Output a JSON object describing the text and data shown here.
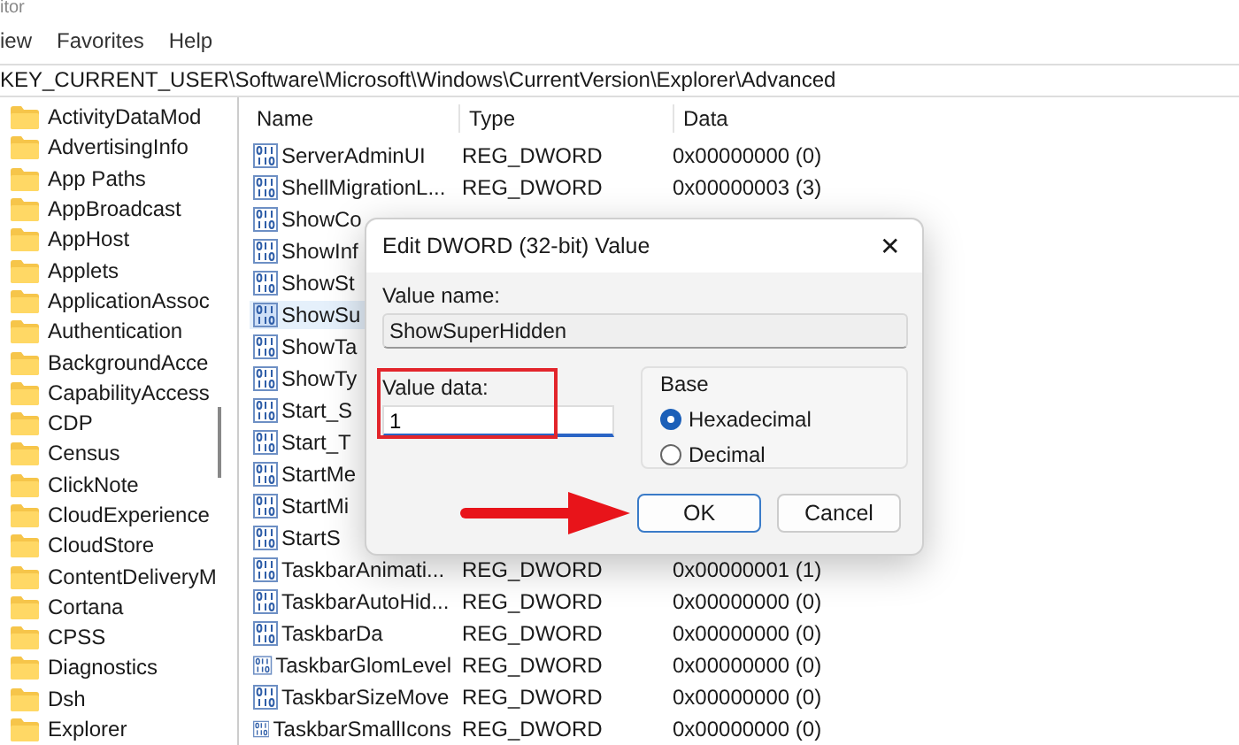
{
  "window": {
    "title": "itor"
  },
  "menu": [
    "iew",
    "Favorites",
    "Help"
  ],
  "address": "KEY_CURRENT_USER\\Software\\Microsoft\\Windows\\CurrentVersion\\Explorer\\Advanced",
  "tree": {
    "items": [
      "ActivityDataMod",
      "AdvertisingInfo",
      "App Paths",
      "AppBroadcast",
      "AppHost",
      "Applets",
      "ApplicationAssoc",
      "Authentication",
      "BackgroundAcce",
      "CapabilityAccess",
      "CDP",
      "Census",
      "ClickNote",
      "CloudExperience",
      "CloudStore",
      "ContentDeliveryM",
      "Cortana",
      "CPSS",
      "Diagnostics",
      "Dsh",
      "Explorer"
    ]
  },
  "table": {
    "columns": [
      "Name",
      "Type",
      "Data"
    ],
    "rows": [
      {
        "name": "ServerAdminUI",
        "type": "REG_DWORD",
        "data": "0x00000000 (0)",
        "selected": false
      },
      {
        "name": "ShellMigrationL...",
        "type": "REG_DWORD",
        "data": "0x00000003 (3)",
        "selected": false
      },
      {
        "name": "ShowCo",
        "type": "",
        "data": "",
        "selected": false
      },
      {
        "name": "ShowInf",
        "type": "",
        "data": "",
        "selected": false
      },
      {
        "name": "ShowSt",
        "type": "",
        "data": "",
        "selected": false
      },
      {
        "name": "ShowSu",
        "type": "",
        "data": "",
        "selected": true
      },
      {
        "name": "ShowTa",
        "type": "",
        "data": "",
        "selected": false
      },
      {
        "name": "ShowTy",
        "type": "",
        "data": "",
        "selected": false
      },
      {
        "name": "Start_S",
        "type": "",
        "data": "",
        "selected": false
      },
      {
        "name": "Start_T",
        "type": "",
        "data": "",
        "selected": false
      },
      {
        "name": "StartMe",
        "type": "",
        "data": "",
        "selected": false
      },
      {
        "name": "StartMi",
        "type": "",
        "data": "",
        "selected": false
      },
      {
        "name": "StartS",
        "type": "",
        "data": "",
        "selected": false
      },
      {
        "name": "TaskbarAnimati...",
        "type": "REG_DWORD",
        "data": "0x00000001 (1)",
        "selected": false
      },
      {
        "name": "TaskbarAutoHid...",
        "type": "REG_DWORD",
        "data": "0x00000000 (0)",
        "selected": false
      },
      {
        "name": "TaskbarDa",
        "type": "REG_DWORD",
        "data": "0x00000000 (0)",
        "selected": false
      },
      {
        "name": "TaskbarGlomLevel",
        "type": "REG_DWORD",
        "data": "0x00000000 (0)",
        "selected": false
      },
      {
        "name": "TaskbarSizeMove",
        "type": "REG_DWORD",
        "data": "0x00000000 (0)",
        "selected": false
      },
      {
        "name": "TaskbarSmallIcons",
        "type": "REG_DWORD",
        "data": "0x00000000 (0)",
        "selected": false
      }
    ]
  },
  "dialog": {
    "title": "Edit DWORD (32-bit) Value",
    "close": "✕",
    "value_name_label": "Value name:",
    "value_name": "ShowSuperHidden",
    "value_data_label": "Value data:",
    "value_data": "1",
    "base_label": "Base",
    "base_options": [
      {
        "label": "Hexadecimal",
        "selected": true
      },
      {
        "label": "Decimal",
        "selected": false
      }
    ],
    "buttons": [
      {
        "label": "OK",
        "kind": "default"
      },
      {
        "label": "Cancel",
        "kind": "normal"
      }
    ]
  }
}
